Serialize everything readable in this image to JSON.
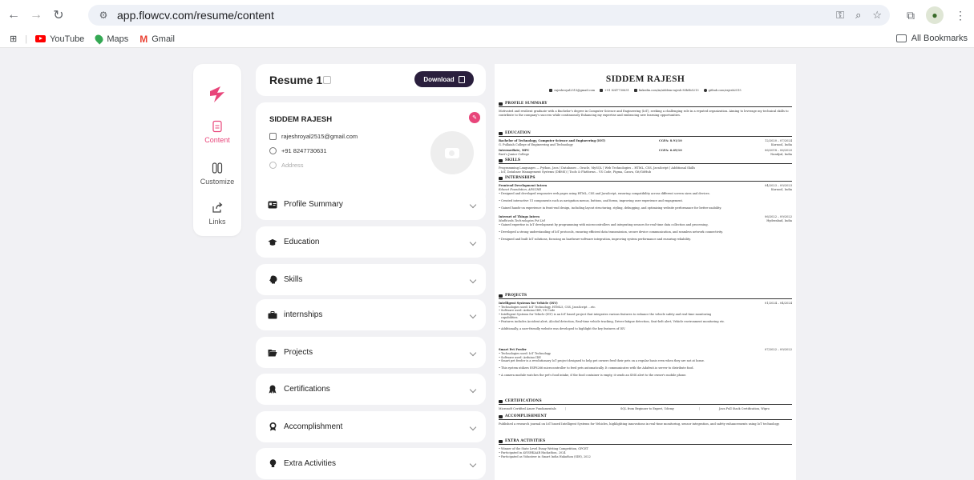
{
  "browser": {
    "url": "app.flowcv.com/resume/content",
    "bookmarks": [
      {
        "label": "YouTube"
      },
      {
        "label": "Maps"
      },
      {
        "label": "Gmail"
      }
    ],
    "all_bookmarks": "All Bookmarks"
  },
  "rail": {
    "items": [
      {
        "label": "Content"
      },
      {
        "label": "Customize"
      },
      {
        "label": "Links"
      }
    ]
  },
  "editor": {
    "title": "Resume 1",
    "download_label": "Download",
    "personal": {
      "name": "SIDDEM RAJESH",
      "email": "rajeshroyal2515@gmail.com",
      "phone": "+91 8247730631",
      "address_placeholder": "Address"
    },
    "sections": [
      {
        "label": "Profile Summary"
      },
      {
        "label": "Education"
      },
      {
        "label": "Skills"
      },
      {
        "label": "internships"
      },
      {
        "label": "Projects"
      },
      {
        "label": "Certifications"
      },
      {
        "label": "Accomplishment"
      },
      {
        "label": "Extra Activities"
      }
    ]
  },
  "resume": {
    "name": "SIDDEM RAJESH",
    "contacts": {
      "email": "rajeshroyal2515@gmail.com",
      "phone": "+91 8247730631",
      "linkedin": "linkedin.com/in/siddem-rajesh-83b8b5213",
      "github": "github.com/rajesh2515"
    },
    "headings": {
      "profile": "PROFILE SUMMARY",
      "education": "EDUCATION",
      "skills": "SKILLS",
      "internships": "INTERNSHIPS",
      "projects": "PROJECTS",
      "certifications": "CERTIFICATIONS",
      "accomplishment": "ACCOMPLISHMENT",
      "extra": "EXTRA ACTIVITIES"
    },
    "profile_text": "Motivated and resilient graduate with a Bachelor's degree in Computer Science and Engineering (IoT), seeking a challenging role in a reputed organization. Aiming to leverage my technical skills to contribute to the company's success while continuously Enhancing my expertise and embracing new learning opportunities.",
    "education": [
      {
        "degree": "Bachelor of Technology, Computer Science and Engineering (IOT)",
        "gpa": "CGPA: 8.91/10",
        "date": "12/2020 – 07/2024",
        "school": "G. Pullaiah College of Engineering and Technology",
        "place": "Kurnool, India"
      },
      {
        "degree": "Intermediate, MPC",
        "gpa": "CGPA: 6.69/10",
        "date": "06/2018 – 06/2020",
        "school": "Ravi's Junior College",
        "place": "Nandyal, India"
      }
    ],
    "skills_line1": "Programming Languages — Python, Java | Databases – Oracle, MySQL | Web Technologies – HTML, CSS, JavaScript | Additional Skills",
    "skills_line2": "– IoT, Database Management Systems (DBMS) | Tools & Platforms – VS Code, Figma, Canva, Git/GitHub",
    "internships": [
      {
        "role": "Frontend Development Intern",
        "company": "Edunet Foundation, APSCHE",
        "date": "04/2023 – 09/2023",
        "place": "Kurnool, India",
        "bullets": [
          "Designed and developed responsive web pages using HTML, CSS and JavaScript, ensuring compatibility across different screen sizes and devices.",
          "Created interactive UI components such as navigation menus, buttons, and forms, improving user experience and engagement.",
          "Gained hands-on experience in front-end design, including layout structuring, styling, debugging, and optimizing website performance for better usability."
        ]
      },
      {
        "role": "Internet of Things Intern",
        "company": "Madhivals Technologies Pvt Ltd",
        "date": "06/2022 – 09/2022",
        "place": "Hyderabad, India",
        "bullets": [
          "Gained expertise in IoT development by programming with microcontrollers and integrating sensors for real-time data collection and processing.",
          "Developed a strong understanding of IoT protocols, ensuring efficient data transmission, secure device communication, and seamless network connectivity.",
          "Designed and built IoT solutions, focusing on hardware-software integration, improving system performance and ensuring reliability."
        ]
      }
    ],
    "projects": [
      {
        "title": "Intelligent Systems for Vehicle (ISV)",
        "date": "01/2024 – 04/2024",
        "bullets": [
          "Technologies used: IoT Technology, HTML5, CSS, JavaScript ...etc.",
          "Software used: Arduino IDE, VS Code",
          "Intelligent Systems for Vehicle (ISV) is an IoT based project that integrates various features to enhance the vehicle safety and real-time monitoring capabilities.",
          "Features includes Accident alert, Alcohol detection, Real-time vehicle tracking, Driver fatigue detection, Seat-belt alert, Vehicle environment monitoring etc.",
          "Additionally, a user-friendly website was developed to highlight the key features of ISV."
        ]
      },
      {
        "title": "Smart Pet Feeder",
        "date": "07/2022 – 09/2022",
        "bullets": [
          "Technologies used: IoT Technology",
          "Software used: Arduino IDE",
          "Smart pet feeder is a revolutionary IoT project designed to help pet owners feed their pets on a regular basis even when they are not at home.",
          "This system utilizes ESP8266 microcontroller to feed pets automatically. It communicates with the Adafruit.io server to distribute food.",
          "A camera module watches the pet's food intake, if the food container is empty, it sends an SMS alert to the owner's mobile phone."
        ]
      }
    ],
    "certifications": [
      "Microsoft Certified Azure Fundamentals",
      "SQL from Beginner to Expert, Udemy",
      "Java Full Stack Certification, Wipro"
    ],
    "accomplishment": "Published a research journal on IoT based Intelligent Systems for Vehicles, highlighting innovations in real-time monitoring, sensor integration, and safety enhancements using IoT technology.",
    "extra": [
      "Winner of the State Level Essay Writing Competition, GPCET",
      "Participated in AVISHKAAR Hackathon, 2024",
      "Participated as Volunteer in Smart India Hakathon (SIH), 2022"
    ]
  },
  "colors": {
    "accent": "#e8457a",
    "dark_button": "#2a1f3d"
  }
}
